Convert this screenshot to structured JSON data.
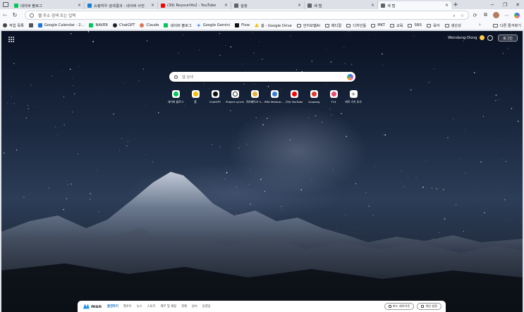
{
  "tabs": [
    {
      "title": "네이버 블로그",
      "color": "#03c75a",
      "width": 104
    },
    {
      "title": "쇼핑하우 검색결과 : 네이버 사전",
      "color": "#1a7fd4",
      "width": 104
    },
    {
      "title": "(39) Reyourlife2 - YouTube",
      "color": "#ff0000",
      "width": 104
    },
    {
      "title": "설정",
      "color": "#5f6368",
      "width": 104
    },
    {
      "title": "새 탭",
      "color": "#5f6368",
      "width": 104
    },
    {
      "title": "새 탭",
      "color": "#5f6368",
      "width": 104,
      "active": true
    }
  ],
  "tab_close": "×",
  "new_tab": "+",
  "window": {
    "minimize": "−",
    "maximize": "❐",
    "close": "✕"
  },
  "nav": {
    "back": "←",
    "reload": "↻"
  },
  "omnibox": {
    "placeholder": "웹 주소 검색 또는 입력"
  },
  "toolbar_icons": [
    "☆",
    "⟳",
    "⋯"
  ],
  "bookmarks": [
    {
      "label": "작업 목록",
      "color": "#444444",
      "icon": "circle"
    },
    {
      "label": "",
      "color": "#555555",
      "icon": "square"
    },
    {
      "label": "Google Calendar - 2...",
      "color": "#1a73e8",
      "icon": "square"
    },
    {
      "label": "NAVER",
      "color": "#03c75a",
      "icon": "square"
    },
    {
      "label": "ChatGPT",
      "color": "#222222",
      "icon": "circle"
    },
    {
      "label": "Claude",
      "color": "#d97757",
      "icon": "circle"
    },
    {
      "label": "네이버 블로그",
      "color": "#03c75a",
      "icon": "square"
    },
    {
      "label": "Google Gemini",
      "color": "#4285f4",
      "icon": "star"
    },
    {
      "label": "Flow",
      "color": "#111111",
      "icon": "square"
    },
    {
      "label": "홈 - Google Drive",
      "color": "#fbbc04",
      "icon": "triangle"
    },
    {
      "label": "언어모델AI",
      "color": "#555555",
      "icon": "folder"
    },
    {
      "label": "메디컬",
      "color": "#555555",
      "icon": "folder"
    },
    {
      "label": "디자인툴",
      "color": "#555555",
      "icon": "folder"
    },
    {
      "label": "MKT",
      "color": "#555555",
      "icon": "folder"
    },
    {
      "label": "교육",
      "color": "#555555",
      "icon": "folder"
    },
    {
      "label": "SNS",
      "color": "#555555",
      "icon": "folder"
    },
    {
      "label": "육아",
      "color": "#555555",
      "icon": "folder"
    },
    {
      "label": "생산성",
      "color": "#555555",
      "icon": "folder"
    }
  ],
  "bookmark_more": "›",
  "other_bookmarks": "다른 즐겨찾기",
  "ntp": {
    "weather_location": "Wondang-Dong",
    "login_label": "로그인",
    "search_placeholder": "웹 검색",
    "quick_links": [
      {
        "label": "네이버 블로그",
        "color": "#03c75a"
      },
      {
        "label": "홈",
        "color": "#fbbc04"
      },
      {
        "label": "ChatGPT",
        "color": "#111111"
      },
      {
        "label": "Project Lyncis",
        "color": "#ffffff"
      },
      {
        "label": "아라베이크 3...",
        "color": "#e8b03a"
      },
      {
        "label": "RRA Medical ...",
        "color": "#3b7dd8"
      },
      {
        "label": "(39) YouTube",
        "color": "#ff0000"
      },
      {
        "label": "Coupang",
        "color": "#e03a2f"
      },
      {
        "label": "T14",
        "color": "#e94b6b"
      },
      {
        "label": "바로 가기 추가",
        "color": "#ffffff",
        "add": true
      }
    ],
    "feed": {
      "brand": "msn",
      "items": [
        "발견하기",
        "팔로우",
        "뉴스",
        "스포츠",
        "재무 및 재정",
        "경제",
        "날씨",
        "동영상"
      ],
      "active_index": 0,
      "right_buttons": [
        "피드 레이아웃",
        "개인 설정"
      ]
    }
  }
}
